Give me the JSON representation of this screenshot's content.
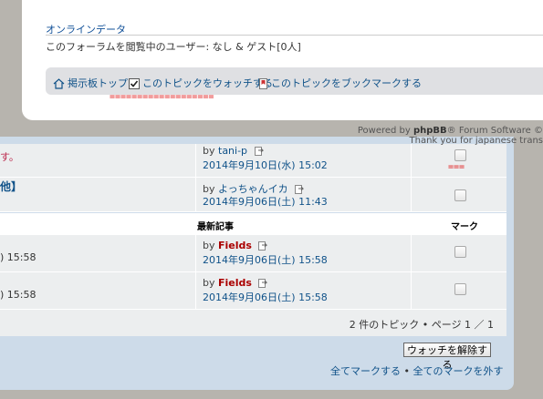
{
  "online": {
    "title": "オンラインデータ",
    "users_text": "このフォーラムを閲覧中のユーザー: なし & ゲスト[0人]"
  },
  "nav": {
    "home": "掲示板トップ",
    "watch": "このトピックをウォッチする",
    "bookmark": "このトピックをブックマークする",
    "underline": "==================="
  },
  "powered": {
    "prefix": "Powered by ",
    "brand": "phpBB",
    "suffix": "® Forum Software ©",
    "thanks": "Thank you for japanese trans"
  },
  "top_rows": [
    {
      "left_text": "す。",
      "by": "by",
      "author": "tani-p",
      "date": "2014年9月10日(水) 15:02"
    },
    {
      "left_text": "他】",
      "by": "by",
      "author": "よっちゃんイカ",
      "date": "2014年9月06日(土) 11:43"
    }
  ],
  "red_marker": "===",
  "header": {
    "last_post": "最新記事",
    "mark": "マーク"
  },
  "bottom_rows": [
    {
      "left_text": ") 15:58",
      "by": "by",
      "author": "Fields",
      "date": "2014年9月06日(土) 15:58"
    },
    {
      "left_text": ") 15:58",
      "by": "by",
      "author": "Fields",
      "date": "2014年9月06日(土) 15:58"
    }
  ],
  "pagination": "2 件のトピック • ページ 1 ／ 1",
  "unwatch_button": "ウォッチを解除する",
  "mark_all": "全てマークする",
  "separator": "•",
  "unmark_all": "全てのマークを外す",
  "colors": {
    "link": "#105289",
    "author_red": "#aa0000",
    "panel_blue": "#cddbe9",
    "row_grey": "#eceeef",
    "marker_red": "#e02020"
  }
}
